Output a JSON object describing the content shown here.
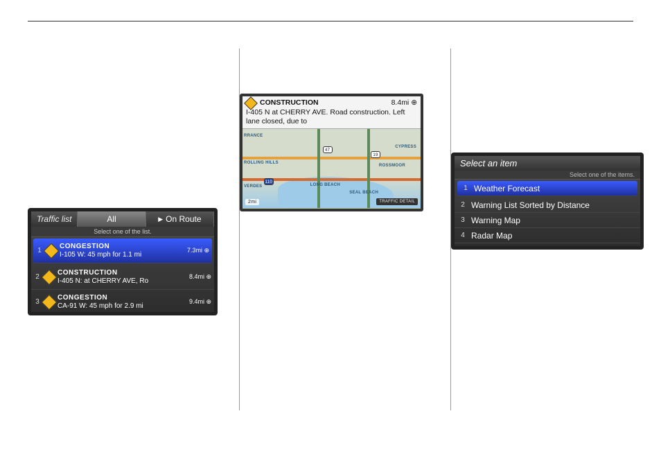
{
  "traffic_list": {
    "title": "Traffic list",
    "tabs": [
      {
        "label": "All",
        "active": true
      },
      {
        "label": "On Route",
        "active": false
      }
    ],
    "subtitle": "Select one of the list.",
    "rows": [
      {
        "num": "1",
        "type": "CONGESTION",
        "desc": "I-105 W: 45 mph for 1.1 mi",
        "dist": "7.3mi",
        "selected": true
      },
      {
        "num": "2",
        "type": "CONSTRUCTION",
        "desc": "I-405 N: at CHERRY AVE, Ro",
        "dist": "8.4mi",
        "selected": false
      },
      {
        "num": "3",
        "type": "CONGESTION",
        "desc": "CA-91 W: 45 mph for 2.9 mi",
        "dist": "9.4mi",
        "selected": false
      }
    ]
  },
  "map_detail": {
    "banner_type": "CONSTRUCTION",
    "banner_dist": "8.4mi",
    "banner_body": "I-405 N at CHERRY AVE. Road construction. Left lane closed, due to",
    "labels": {
      "rrance": "RRANCE",
      "cypress": "CYPRESS",
      "rossmoor": "ROSSMOOR",
      "longbeach": "LONG BEACH",
      "sealbeach": "SEAL BEACH",
      "rollinghills": "ROLLING HILLS",
      "verdes": "VERDES"
    },
    "shields": {
      "s47": "47",
      "s19": "19",
      "s110": "110"
    },
    "scale": "2mi",
    "traffic_btn": "TRAFFIC DETAIL"
  },
  "select_item": {
    "title": "Select an item",
    "subtitle": "Select one of the items.",
    "rows": [
      {
        "num": "1",
        "label": "Weather Forecast",
        "selected": true
      },
      {
        "num": "2",
        "label": "Warning List Sorted by Distance",
        "selected": false
      },
      {
        "num": "3",
        "label": "Warning Map",
        "selected": false
      },
      {
        "num": "4",
        "label": "Radar Map",
        "selected": false
      }
    ]
  }
}
